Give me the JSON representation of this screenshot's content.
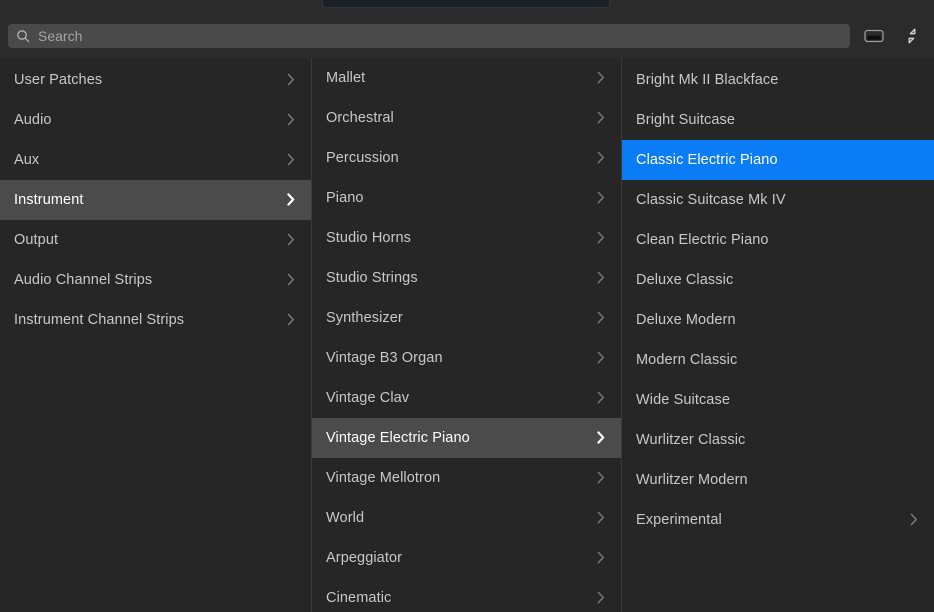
{
  "colors": {
    "window_bg": "#222222",
    "toolbar_bg": "#2b2b2b",
    "column_bg": "#262626",
    "row_active_bg": "#4b4b4b",
    "selection_blue": "#0a7cf5",
    "text": "#c8c8c8",
    "text_selected": "#ffffff",
    "divider": "#3a3a3a",
    "search_field_bg": "#4a4a4a"
  },
  "toolbar": {
    "search": {
      "value": "",
      "placeholder": "Search",
      "icon": "search-icon"
    },
    "buttons": [
      {
        "name": "show-hide-bottom-pane-button",
        "icon": "bottom-pane-icon",
        "tooltip": "Show/Hide Pane"
      },
      {
        "name": "collapse-view-button",
        "icon": "collapse-arrows-icon",
        "tooltip": "Collapse"
      }
    ]
  },
  "columns": {
    "category": {
      "name": "category-column",
      "items": [
        {
          "label": "User Patches",
          "chevron": true,
          "state": "normal"
        },
        {
          "label": "Audio",
          "chevron": true,
          "state": "normal"
        },
        {
          "label": "Aux",
          "chevron": true,
          "state": "normal"
        },
        {
          "label": "Instrument",
          "chevron": true,
          "state": "active"
        },
        {
          "label": "Output",
          "chevron": true,
          "state": "normal"
        },
        {
          "label": "Audio Channel Strips",
          "chevron": true,
          "state": "normal"
        },
        {
          "label": "Instrument Channel Strips",
          "chevron": true,
          "state": "normal"
        }
      ]
    },
    "subcategory": {
      "name": "instrument-subcategory-column",
      "items": [
        {
          "label": "Mallet",
          "chevron": true,
          "state": "normal"
        },
        {
          "label": "Orchestral",
          "chevron": true,
          "state": "normal"
        },
        {
          "label": "Percussion",
          "chevron": true,
          "state": "normal"
        },
        {
          "label": "Piano",
          "chevron": true,
          "state": "normal"
        },
        {
          "label": "Studio Horns",
          "chevron": true,
          "state": "normal"
        },
        {
          "label": "Studio Strings",
          "chevron": true,
          "state": "normal"
        },
        {
          "label": "Synthesizer",
          "chevron": true,
          "state": "normal"
        },
        {
          "label": "Vintage B3 Organ",
          "chevron": true,
          "state": "normal"
        },
        {
          "label": "Vintage Clav",
          "chevron": true,
          "state": "normal"
        },
        {
          "label": "Vintage Electric Piano",
          "chevron": true,
          "state": "active"
        },
        {
          "label": "Vintage Mellotron",
          "chevron": true,
          "state": "normal"
        },
        {
          "label": "World",
          "chevron": true,
          "state": "normal"
        },
        {
          "label": "Arpeggiator",
          "chevron": true,
          "state": "normal"
        },
        {
          "label": "Cinematic",
          "chevron": true,
          "state": "normal"
        }
      ]
    },
    "patches": {
      "name": "patch-column",
      "items": [
        {
          "label": "Bright Mk II Blackface",
          "chevron": false,
          "state": "normal"
        },
        {
          "label": "Bright Suitcase",
          "chevron": false,
          "state": "normal"
        },
        {
          "label": "Classic Electric Piano",
          "chevron": false,
          "state": "selected"
        },
        {
          "label": "Classic Suitcase Mk IV",
          "chevron": false,
          "state": "normal"
        },
        {
          "label": "Clean Electric Piano",
          "chevron": false,
          "state": "normal"
        },
        {
          "label": "Deluxe Classic",
          "chevron": false,
          "state": "normal"
        },
        {
          "label": "Deluxe Modern",
          "chevron": false,
          "state": "normal"
        },
        {
          "label": "Modern Classic",
          "chevron": false,
          "state": "normal"
        },
        {
          "label": "Wide Suitcase",
          "chevron": false,
          "state": "normal"
        },
        {
          "label": "Wurlitzer Classic",
          "chevron": false,
          "state": "normal"
        },
        {
          "label": "Wurlitzer Modern",
          "chevron": false,
          "state": "normal"
        },
        {
          "label": "Experimental",
          "chevron": true,
          "state": "normal"
        }
      ]
    }
  }
}
